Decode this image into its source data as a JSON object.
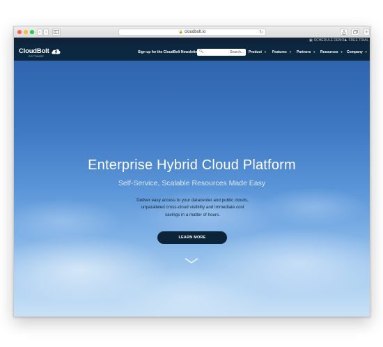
{
  "browser": {
    "url": "cloudbolt.io"
  },
  "utility_nav": {
    "schedule_demo": "SCHEDULE DEMO",
    "free_trial": "FREE TRIAL"
  },
  "header": {
    "logo_text": "CloudBolt",
    "logo_subtext": "SOFTWARE",
    "newsletter": "Sign up for the CloudBolt Newsletter!",
    "search_placeholder": "Search...",
    "nav": [
      "Product",
      "Features",
      "Partners",
      "Resources",
      "Company"
    ]
  },
  "hero": {
    "title": "Enterprise Hybrid Cloud Platform",
    "subtitle": "Self-Service, Scalable Resources Made Easy",
    "description_lines": [
      "Deliver easy access to your datacenter and public clouds,",
      "unparalleled cross-cloud visibility and immediate cost",
      "savings in a matter of hours."
    ],
    "cta_label": "LEARN MORE"
  },
  "colors": {
    "nav_background": "#0c2840",
    "utility_background": "#0f2438",
    "cta_background": "#0c2438",
    "hero_top": "#2f63ad",
    "hero_bottom": "#c9e1f6"
  }
}
